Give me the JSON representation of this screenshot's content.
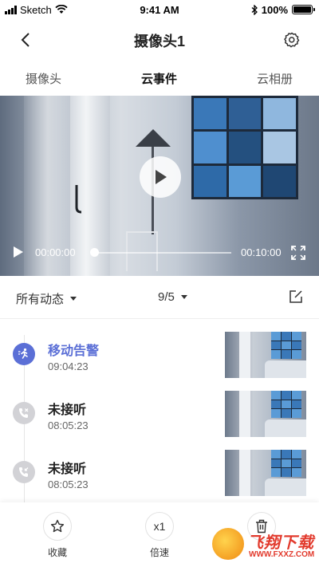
{
  "status_bar": {
    "carrier": "Sketch",
    "time": "9:41 AM",
    "battery": "100%"
  },
  "header": {
    "title": "摄像头1",
    "back_icon": "chevron-left-icon",
    "settings_icon": "gear-icon"
  },
  "tabs": [
    {
      "label": "摄像头",
      "active": false
    },
    {
      "label": "云事件",
      "active": true
    },
    {
      "label": "云相册",
      "active": false
    }
  ],
  "player": {
    "current_time": "00:00:00",
    "total_time": "00:10:00",
    "progress": 0.0
  },
  "filter": {
    "type_label": "所有动态",
    "date_label": "9/5"
  },
  "events": [
    {
      "title": "移动告警",
      "time": "09:04:23",
      "kind": "motion-alert",
      "color": "#5b6fd6"
    },
    {
      "title": "未接听",
      "time": "08:05:23",
      "kind": "missed-call",
      "color": "#d2d2d6"
    },
    {
      "title": "未接听",
      "time": "08:05:23",
      "kind": "missed-call",
      "color": "#d2d2d6"
    }
  ],
  "toolbar": {
    "favorite_label": "收藏",
    "speed_value": "x1",
    "speed_label": "倍速"
  },
  "watermark": {
    "title": "飞翔下载",
    "sub": "WWW.FXXZ.COM"
  }
}
